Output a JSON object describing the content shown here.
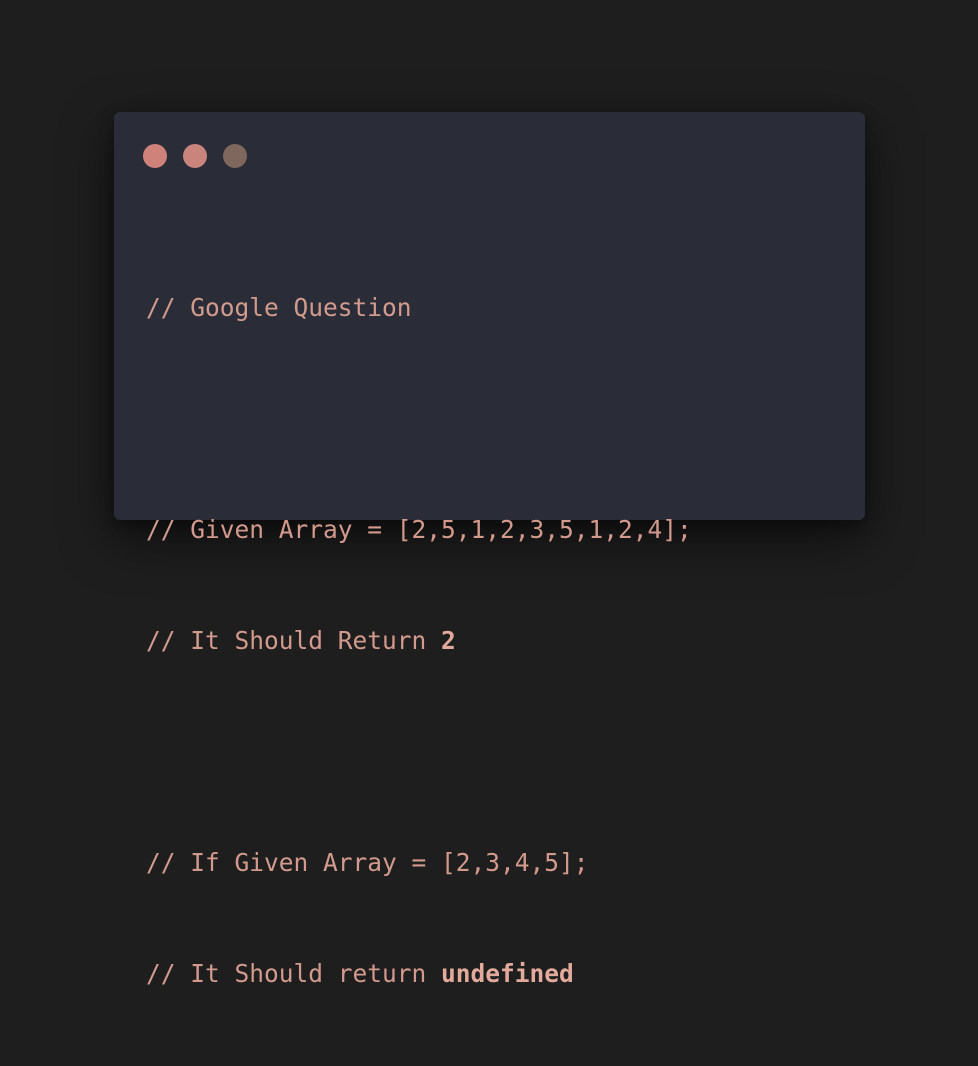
{
  "window": {
    "controls": [
      {
        "name": "close",
        "color": "#cf827a"
      },
      {
        "name": "minimize",
        "color": "#c9847b"
      },
      {
        "name": "maximize",
        "color": "#80675e"
      }
    ]
  },
  "code": {
    "line1": "// Google Question",
    "line2": "",
    "line3": "// Given Array = [2,5,1,2,3,5,1,2,4];",
    "line4_prefix": "// It Should Return ",
    "line4_bold": "2",
    "line5": "",
    "line6": "// If Given Array = [2,3,4,5];",
    "line7_prefix": "// It Should return ",
    "line7_bold": "undefined"
  }
}
